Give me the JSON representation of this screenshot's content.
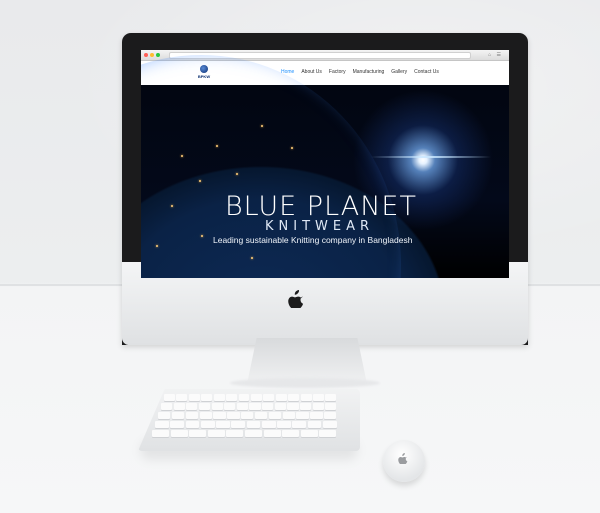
{
  "site": {
    "logo_text": "BPKW",
    "nav": [
      "Home",
      "About Us",
      "Factory",
      "Manufacturing",
      "Gallery",
      "Contact Us"
    ],
    "active_nav_index": 0
  },
  "hero": {
    "title": "BLUE PLANET",
    "subtitle": "KNITWEAR",
    "tagline": "Leading sustainable Knitting company in Bangladesh"
  },
  "colors": {
    "nav_active": "#1e90ff",
    "logo_blue": "#0b2f70",
    "hero_bg": "#03091a"
  },
  "icons": [
    "apple-logo-icon",
    "browser-window-dots-icon",
    "keyboard",
    "magic-mouse"
  ]
}
